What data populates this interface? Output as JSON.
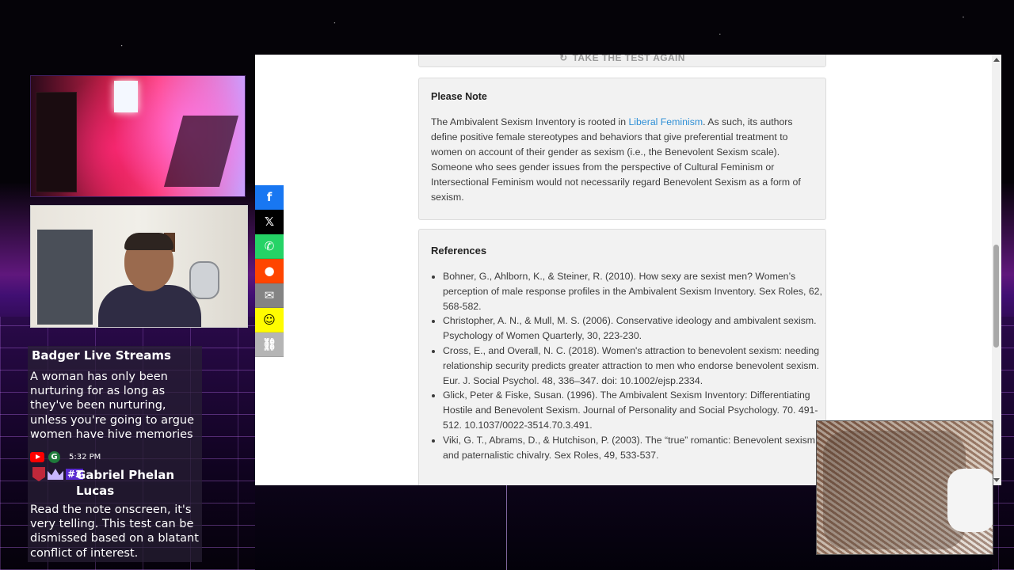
{
  "retake_button": {
    "label": "TAKE THE TEST AGAIN",
    "icon": "refresh-icon"
  },
  "note": {
    "title": "Please Note",
    "text_before_link": "The Ambivalent Sexism Inventory is rooted in ",
    "link_text": "Liberal Feminism",
    "text_after_link": ". As such, its authors define positive female stereotypes and behaviors that give preferential treatment to women on account of their gender as sexism (i.e., the Benevolent Sexism scale). Someone who sees gender issues from the perspective of Cultural Feminism or Intersectional Feminism would not necessarily regard Benevolent Sexism as a form of sexism."
  },
  "references": {
    "title": "References",
    "items": [
      "Bohner, G., Ahlborn, K., & Steiner, R. (2010). How sexy are sexist men? Women’s perception of male response profiles in the Ambivalent Sexism Inventory. Sex Roles, 62, 568-582.",
      "Christopher, A. N., & Mull, M. S. (2006). Conservative ideology and ambivalent sexism. Psychology of Women Quarterly, 30, 223-230.",
      "Cross, E., and Overall, N. C. (2018). Women's attraction to benevolent sexism: needing relationship security predicts greater attraction to men who endorse benevolent sexism. Eur. J. Social Psychol. 48, 336–347. doi: 10.1002/ejsp.2334.",
      "Glick, Peter & Fiske, Susan. (1996). The Ambivalent Sexism Inventory: Differentiating Hostile and Benevolent Sexism. Journal of Personality and Social Psychology. 70. 491-512. 10.1037/0022-3514.70.3.491.",
      "Viki, G. T., Abrams, D., & Hutchison, P. (2003). The “true” romantic: Benevolent sexism and paternalistic chivalry. Sex Roles, 49, 533-537."
    ]
  },
  "share_bar": {
    "buttons": [
      {
        "name": "facebook",
        "glyph": "f"
      },
      {
        "name": "x",
        "glyph": "𝕏"
      },
      {
        "name": "whatsapp",
        "glyph": "✆"
      },
      {
        "name": "reddit",
        "glyph": "●"
      },
      {
        "name": "email",
        "glyph": "✉"
      },
      {
        "name": "snapchat",
        "glyph": "☺"
      },
      {
        "name": "copy-link",
        "glyph": "⛓"
      }
    ]
  },
  "chat": {
    "message1": {
      "author": "Badger Live Streams",
      "text": "A woman has only been nurturing for as long as they've been nurturing, unless you're going to argue women have hive memories"
    },
    "meta": {
      "platform_badge": "G",
      "time": "5:32 PM"
    },
    "message2": {
      "rank_badge": "#3",
      "author": "Gabriel Phelan Lucas",
      "text": "Read the note onscreen, it's very telling. This test can be dismissed based on a blatant conflict of interest."
    }
  },
  "colors": {
    "link": "#2e8fd6",
    "card_bg": "#f2f2f2",
    "facebook": "#1877f2",
    "whatsapp": "#25d366",
    "reddit": "#ff4500",
    "snapchat": "#fffc00"
  }
}
